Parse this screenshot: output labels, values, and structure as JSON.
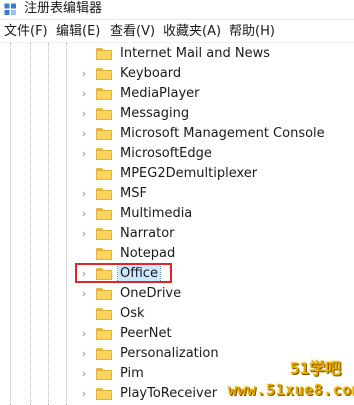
{
  "window": {
    "title": "注册表编辑器"
  },
  "menu": [
    {
      "label": "文件(F)"
    },
    {
      "label": "编辑(E)"
    },
    {
      "label": "查看(V)"
    },
    {
      "label": "收藏夹(A)"
    },
    {
      "label": "帮助(H)"
    }
  ],
  "tree": {
    "items": [
      {
        "label": "Internet Mail and News",
        "expandable": false
      },
      {
        "label": "Keyboard",
        "expandable": true
      },
      {
        "label": "MediaPlayer",
        "expandable": true
      },
      {
        "label": "Messaging",
        "expandable": true
      },
      {
        "label": "Microsoft Management Console",
        "expandable": true
      },
      {
        "label": "MicrosoftEdge",
        "expandable": true
      },
      {
        "label": "MPEG2Demultiplexer",
        "expandable": false
      },
      {
        "label": "MSF",
        "expandable": true
      },
      {
        "label": "Multimedia",
        "expandable": true
      },
      {
        "label": "Narrator",
        "expandable": true
      },
      {
        "label": "Notepad",
        "expandable": false
      },
      {
        "label": "Office",
        "expandable": true,
        "selected": true
      },
      {
        "label": "OneDrive",
        "expandable": true
      },
      {
        "label": "Osk",
        "expandable": false
      },
      {
        "label": "PeerNet",
        "expandable": true
      },
      {
        "label": "Personalization",
        "expandable": true
      },
      {
        "label": "Pim",
        "expandable": true
      },
      {
        "label": "PlayToReceiver",
        "expandable": true
      }
    ]
  },
  "watermark": {
    "brand": "51学吧",
    "url": "www.51xue8.com"
  },
  "colors": {
    "highlight_box": "#e0252b",
    "folder": "#ffd35c",
    "selection": "#cce8ff"
  }
}
